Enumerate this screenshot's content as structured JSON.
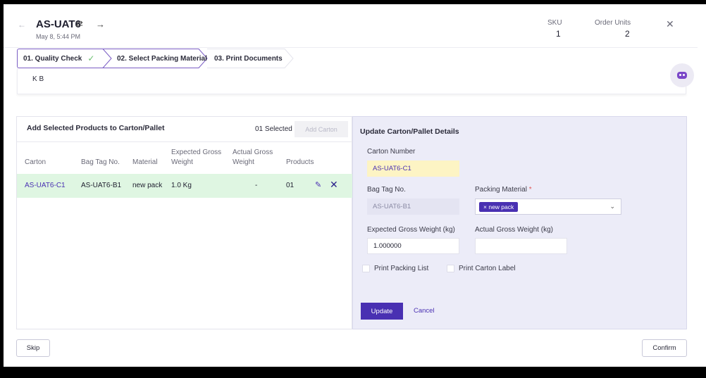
{
  "header": {
    "title": "AS-UAT6",
    "date": "May 8, 5:44 PM",
    "sku_label": "SKU",
    "sku_value": "1",
    "order_units_label": "Order Units",
    "order_units_value": "2",
    "back_icon": "arrow-left-icon",
    "swap_icon": "swap-icon",
    "forward_icon": "arrow-right-icon",
    "close_icon": "close-icon"
  },
  "stepper": {
    "steps": [
      {
        "label": "01. Quality Check",
        "state": "done"
      },
      {
        "label": "02. Select Packing Material",
        "state": "active"
      },
      {
        "label": "03. Print Documents",
        "state": "pending"
      }
    ]
  },
  "note": {
    "text": "K B"
  },
  "left_panel": {
    "title": "Add Selected Products to Carton/Pallet",
    "selected_text": "01 Selected",
    "add_carton_label": "Add Carton",
    "columns": [
      "Carton",
      "Bag Tag No.",
      "Material",
      "Expected Gross Weight",
      "Actual Gross Weight",
      "Products"
    ],
    "column_lines": [
      [
        "Carton"
      ],
      [
        "Bag Tag No."
      ],
      [
        "Material"
      ],
      [
        "Expected Gross",
        "Weight"
      ],
      [
        "Actual Gross",
        "Weight"
      ],
      [
        "Products"
      ]
    ],
    "rows": [
      {
        "carton": "AS-UAT6-C1",
        "bag_tag": "AS-UAT6-B1",
        "material": "new pack",
        "expected_weight": "1.0 Kg",
        "actual_weight": "-",
        "products": "01"
      }
    ]
  },
  "right_panel": {
    "title": "Update Carton/Pallet Details",
    "carton_number_label": "Carton Number",
    "carton_number_value": "AS-UAT6-C1",
    "bag_tag_label": "Bag Tag No.",
    "bag_tag_value": "AS-UAT6-B1",
    "packing_material_label": "Packing Material",
    "required_mark": "*",
    "packing_material_chip": "new pack",
    "chip_remove": "×",
    "expected_weight_label": "Expected Gross Weight (kg)",
    "expected_weight_value": "1.000000",
    "actual_weight_label": "Actual Gross Weight (kg)",
    "actual_weight_value": "",
    "print_packing_list_label": "Print Packing List",
    "print_carton_label_label": "Print Carton Label",
    "update_label": "Update",
    "cancel_label": "Cancel"
  },
  "footer": {
    "skip_label": "Skip",
    "confirm_label": "Confirm"
  },
  "colors": {
    "accent": "#4930b2",
    "success_row": "#dff6e2",
    "panel_bg": "#ececf8",
    "highlight_field": "#fdf4c4"
  }
}
